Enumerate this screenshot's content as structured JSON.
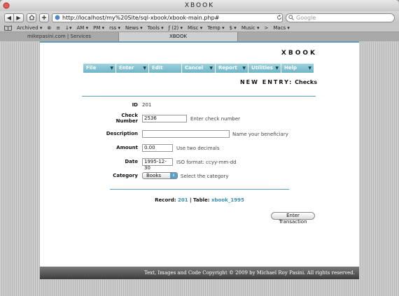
{
  "window": {
    "title": "XBOOK"
  },
  "toolbar": {
    "back_icon": "◀",
    "forward_icon": "▶",
    "url": "http://localhost/my%20Site/sql-xbook/xbook-main.php#",
    "search_placeholder": "Google"
  },
  "bookmarks": [
    "Archived ▾",
    "⊗",
    "≡",
    "↓▾",
    "AM ▾",
    "PM ▾",
    "rss ▾",
    "News ▾",
    "Tools ▾",
    "ƒ (2) ▾",
    "Misc ▾",
    "Temp ▾",
    "$ ▾",
    "Music ▾",
    ">",
    "Macs ▾"
  ],
  "tabs": [
    "mikepasini.com | Services",
    "XBOOK"
  ],
  "page": {
    "brand": "XBOOK",
    "menus": [
      {
        "label": "File",
        "arrow": "▼"
      },
      {
        "label": "Enter",
        "arrow": "▼"
      },
      {
        "label": "Edit",
        "arrow": ""
      },
      {
        "label": "Cancel",
        "arrow": "▼"
      },
      {
        "label": "Report",
        "arrow": "▼"
      },
      {
        "label": "Utilities",
        "arrow": "▼"
      },
      {
        "label": "Help",
        "arrow": "▼"
      }
    ],
    "heading_lead": "NEW ENTRY:",
    "heading_name": "Checks",
    "form": {
      "id_label": "ID",
      "id_value": "201",
      "check_label_1": "Check",
      "check_label_2": "Number",
      "check_value": "2536",
      "check_hint": "Enter check number",
      "desc_label": "Description",
      "desc_value": "",
      "desc_hint": "Name your beneficiary",
      "amount_label": "Amount",
      "amount_value": "0.00",
      "amount_hint": "Use two decimals",
      "date_label": "Date",
      "date_value": "1995-12-30",
      "date_hint": "ISO format: ccyy-mm-dd",
      "category_label": "Category",
      "category_value": "Books",
      "category_hint": "Select the category"
    },
    "record_label": "Record:",
    "record_value": "201",
    "record_sep": "|",
    "table_label": "Table:",
    "table_value": "xbook_1995",
    "submit_label": "Enter Transaction",
    "footer": "Text, Images and Code Copyright © 2009 by Michael Roy Pasini. All rights reserved."
  }
}
